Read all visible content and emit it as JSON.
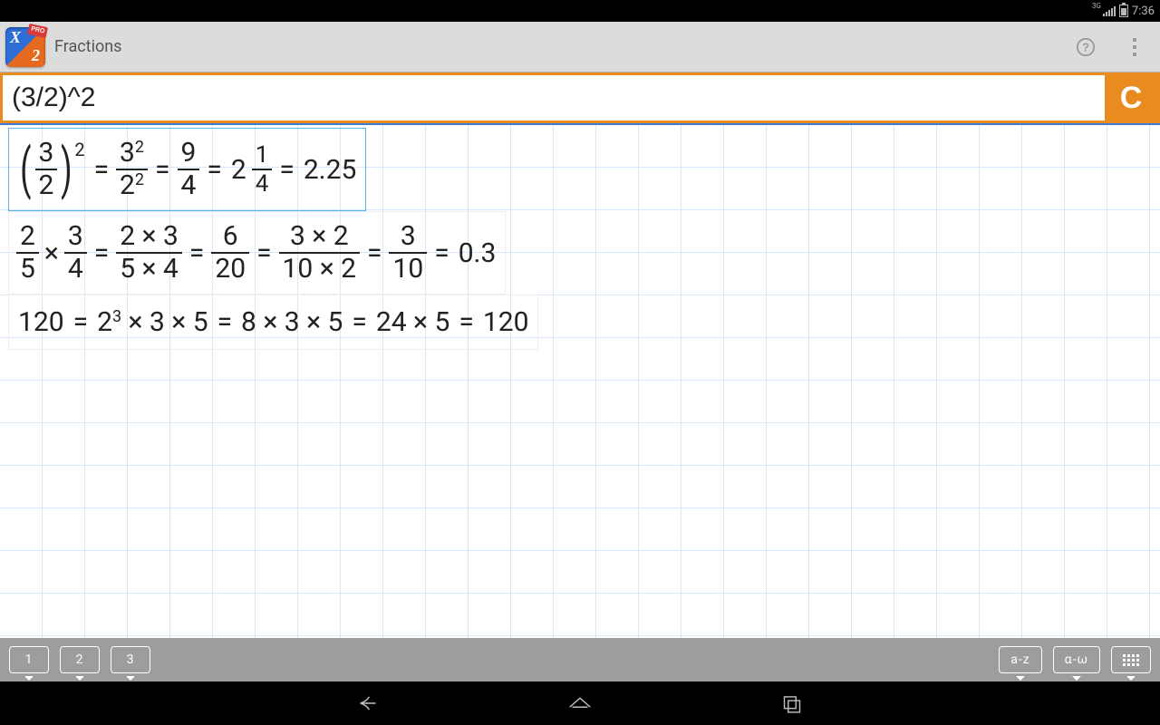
{
  "statusbar": {
    "network": "3G",
    "time": "7:36"
  },
  "titlebar": {
    "title": "Fractions"
  },
  "input": {
    "value": "(3/2)^2",
    "clear_label": "C"
  },
  "keypad": {
    "tab1": "1",
    "tab2": "2",
    "tab3": "3",
    "alpha": "a-z",
    "greek": "α-ω"
  },
  "appicon": {
    "pro": "PRO"
  },
  "rows": {
    "r0": {
      "base_n": "3",
      "base_d": "2",
      "base_exp": "2",
      "s1_nb": "3",
      "s1_ne": "2",
      "s1_db": "2",
      "s1_de": "2",
      "s2_n": "9",
      "s2_d": "4",
      "m_whole": "2",
      "m_n": "1",
      "m_d": "4",
      "dec": "2.25"
    },
    "r1": {
      "a_n": "2",
      "a_d": "5",
      "b_n": "3",
      "b_d": "4",
      "s1_n": "2 × 3",
      "s1_d": "5 × 4",
      "s2_n": "6",
      "s2_d": "20",
      "s3_n": "3 × 2",
      "s3_d": "10 × 2",
      "s4_n": "3",
      "s4_d": "10",
      "dec": "0.3"
    },
    "r2": {
      "lhs": "120",
      "p_b": "2",
      "p_e": "3",
      "p_rest": " × 3 × 5",
      "s2": "8 × 3 × 5",
      "s3": "24 × 5",
      "s4": "120"
    }
  }
}
